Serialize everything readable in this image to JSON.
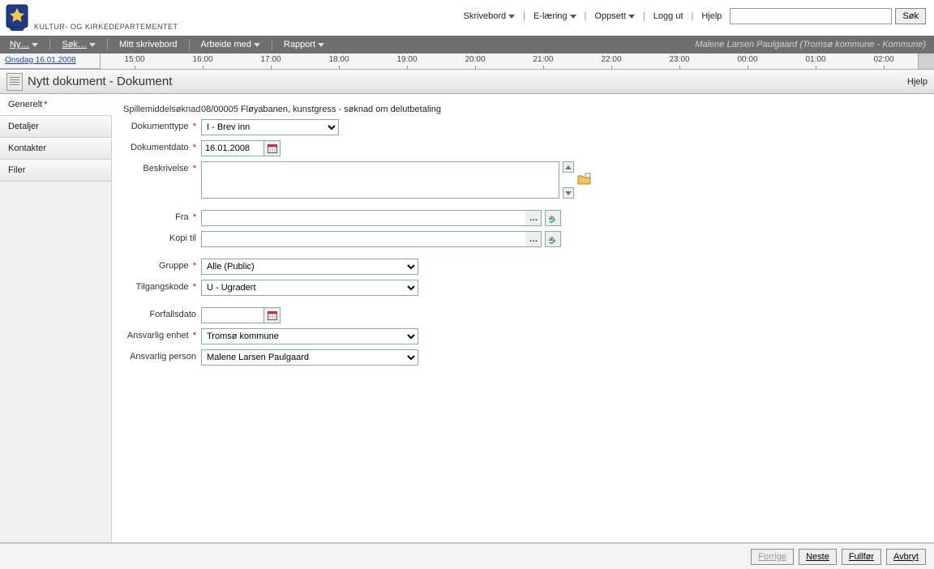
{
  "header": {
    "org_name": "KULTUR- OG KIRKEDEPARTEMENTET",
    "nav": {
      "skrivebord": "Skrivebord",
      "elaering": "E-læring",
      "oppsett": "Oppsett",
      "loggut": "Logg ut",
      "hjelp": "Hjelp"
    },
    "search": {
      "placeholder": "",
      "button": "Søk"
    }
  },
  "darkbar": {
    "ny": "Ny…",
    "sok": "Søk…",
    "mitt_skrivebord": "Mitt skrivebord",
    "arbeide_med": "Arbeide med",
    "rapport": "Rapport",
    "user": "Malene Larsen Paulgaard (Tromsø kommune - Kommune)"
  },
  "timeline": {
    "date": "Onsdag 16.01.2008",
    "ticks": [
      "15:00",
      "16:00",
      "17:00",
      "18:00",
      "19:00",
      "20:00",
      "21:00",
      "22:00",
      "23:00",
      "00:00",
      "01:00",
      "02:00"
    ]
  },
  "title": {
    "text": "Nytt dokument - Dokument",
    "help": "Hjelp"
  },
  "side_tabs": [
    {
      "label": "Generelt",
      "required": true,
      "active": true
    },
    {
      "label": "Detaljer",
      "required": false,
      "active": false
    },
    {
      "label": "Kontakter",
      "required": false,
      "active": false
    },
    {
      "label": "Filer",
      "required": false,
      "active": false
    }
  ],
  "form": {
    "spillemiddel": {
      "label": "Spillemiddelsøknad",
      "value": "08/00005 Fløyabanen, kunstgress - søknad om delutbetaling"
    },
    "dokumenttype": {
      "label": "Dokumenttype",
      "value": "I - Brev inn"
    },
    "dokumentdato": {
      "label": "Dokumentdato",
      "value": "16.01.2008"
    },
    "beskrivelse": {
      "label": "Beskrivelse",
      "value": ""
    },
    "fra": {
      "label": "Fra",
      "value": ""
    },
    "kopi_til": {
      "label": "Kopi til",
      "value": ""
    },
    "gruppe": {
      "label": "Gruppe",
      "value": "Alle (Public)"
    },
    "tilgangskode": {
      "label": "Tilgangskode",
      "value": "U - Ugradert"
    },
    "forfallsdato": {
      "label": "Forfallsdato",
      "value": ""
    },
    "ansvarlig_enhet": {
      "label": "Ansvarlig enhet",
      "value": "Tromsø kommune"
    },
    "ansvarlig_person": {
      "label": "Ansvarlig person",
      "value": "Malene Larsen Paulgaard"
    }
  },
  "footer": {
    "forrige": "Forrige",
    "neste": "Neste",
    "fullfor": "Fullfør",
    "avbryt": "Avbryt"
  }
}
